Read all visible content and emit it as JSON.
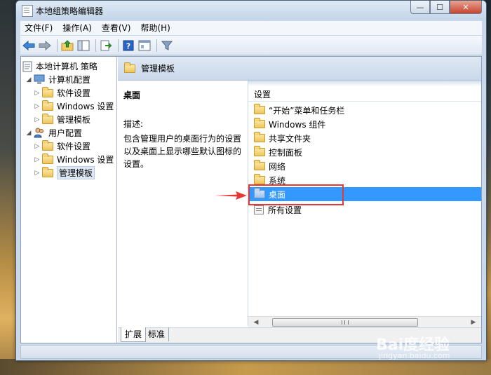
{
  "window": {
    "title": "本地组策略编辑器"
  },
  "menu": [
    "文件(F)",
    "操作(A)",
    "查看(V)",
    "帮助(H)"
  ],
  "tree": {
    "root": "本地计算机 策略",
    "computer_config": "计算机配置",
    "user_config": "用户配置",
    "software": "软件设置",
    "windows": "Windows 设置",
    "admin_templates": "管理模板"
  },
  "right": {
    "header_title": "管理模板",
    "column_header": "设置",
    "list": [
      "“开始”菜单和任务栏",
      "Windows 组件",
      "共享文件夹",
      "控制面板",
      "网络",
      "系统",
      "桌面",
      "所有设置"
    ],
    "selected_item": "桌面"
  },
  "description": {
    "title": "桌面",
    "label": "描述:",
    "text": "包含管理用户的桌面行为的设置以及桌面上显示哪些默认图标的设置。"
  },
  "tabs": {
    "extended": "扩展",
    "standard": "标准"
  },
  "colors": {
    "selection": "#3399ff",
    "annotation": "#e53935"
  },
  "watermark": {
    "brand": "Bai度经验",
    "url": "jingyan.baidu.com"
  }
}
